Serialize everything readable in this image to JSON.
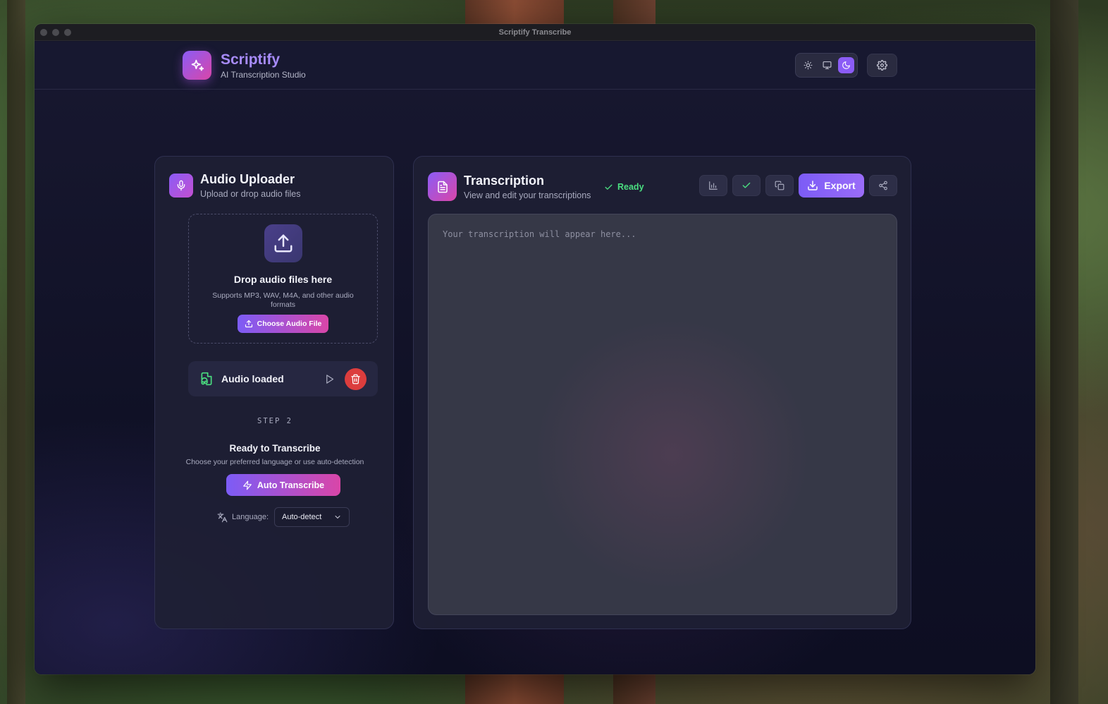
{
  "window": {
    "title": "Scriptify Transcribe"
  },
  "header": {
    "brand_name": "Scriptify",
    "brand_subtitle": "AI Transcription Studio",
    "theme_modes": [
      "light",
      "system",
      "dark"
    ],
    "active_theme": "dark"
  },
  "uploader": {
    "title": "Audio Uploader",
    "subtitle": "Upload or drop audio files",
    "drop_title": "Drop audio files here",
    "drop_subtitle": "Supports MP3, WAV, M4A, and other audio formats",
    "choose_button": "Choose Audio File",
    "audio_status": "Audio loaded",
    "step_label": "STEP 2",
    "ready_title": "Ready to Transcribe",
    "ready_subtitle": "Choose your preferred language or use auto-detection",
    "transcribe_button": "Auto Transcribe",
    "language_label": "Language:",
    "language_value": "Auto-detect"
  },
  "transcription": {
    "title": "Transcription",
    "subtitle": "View and edit your transcriptions",
    "status": "Ready",
    "export_button": "Export",
    "placeholder": "Your transcription will appear here...",
    "text": ""
  },
  "colors": {
    "accent": "#8b5cf6",
    "accent_pink": "#d946a8",
    "status_green": "#4ade80",
    "danger": "#dc3d3d"
  }
}
